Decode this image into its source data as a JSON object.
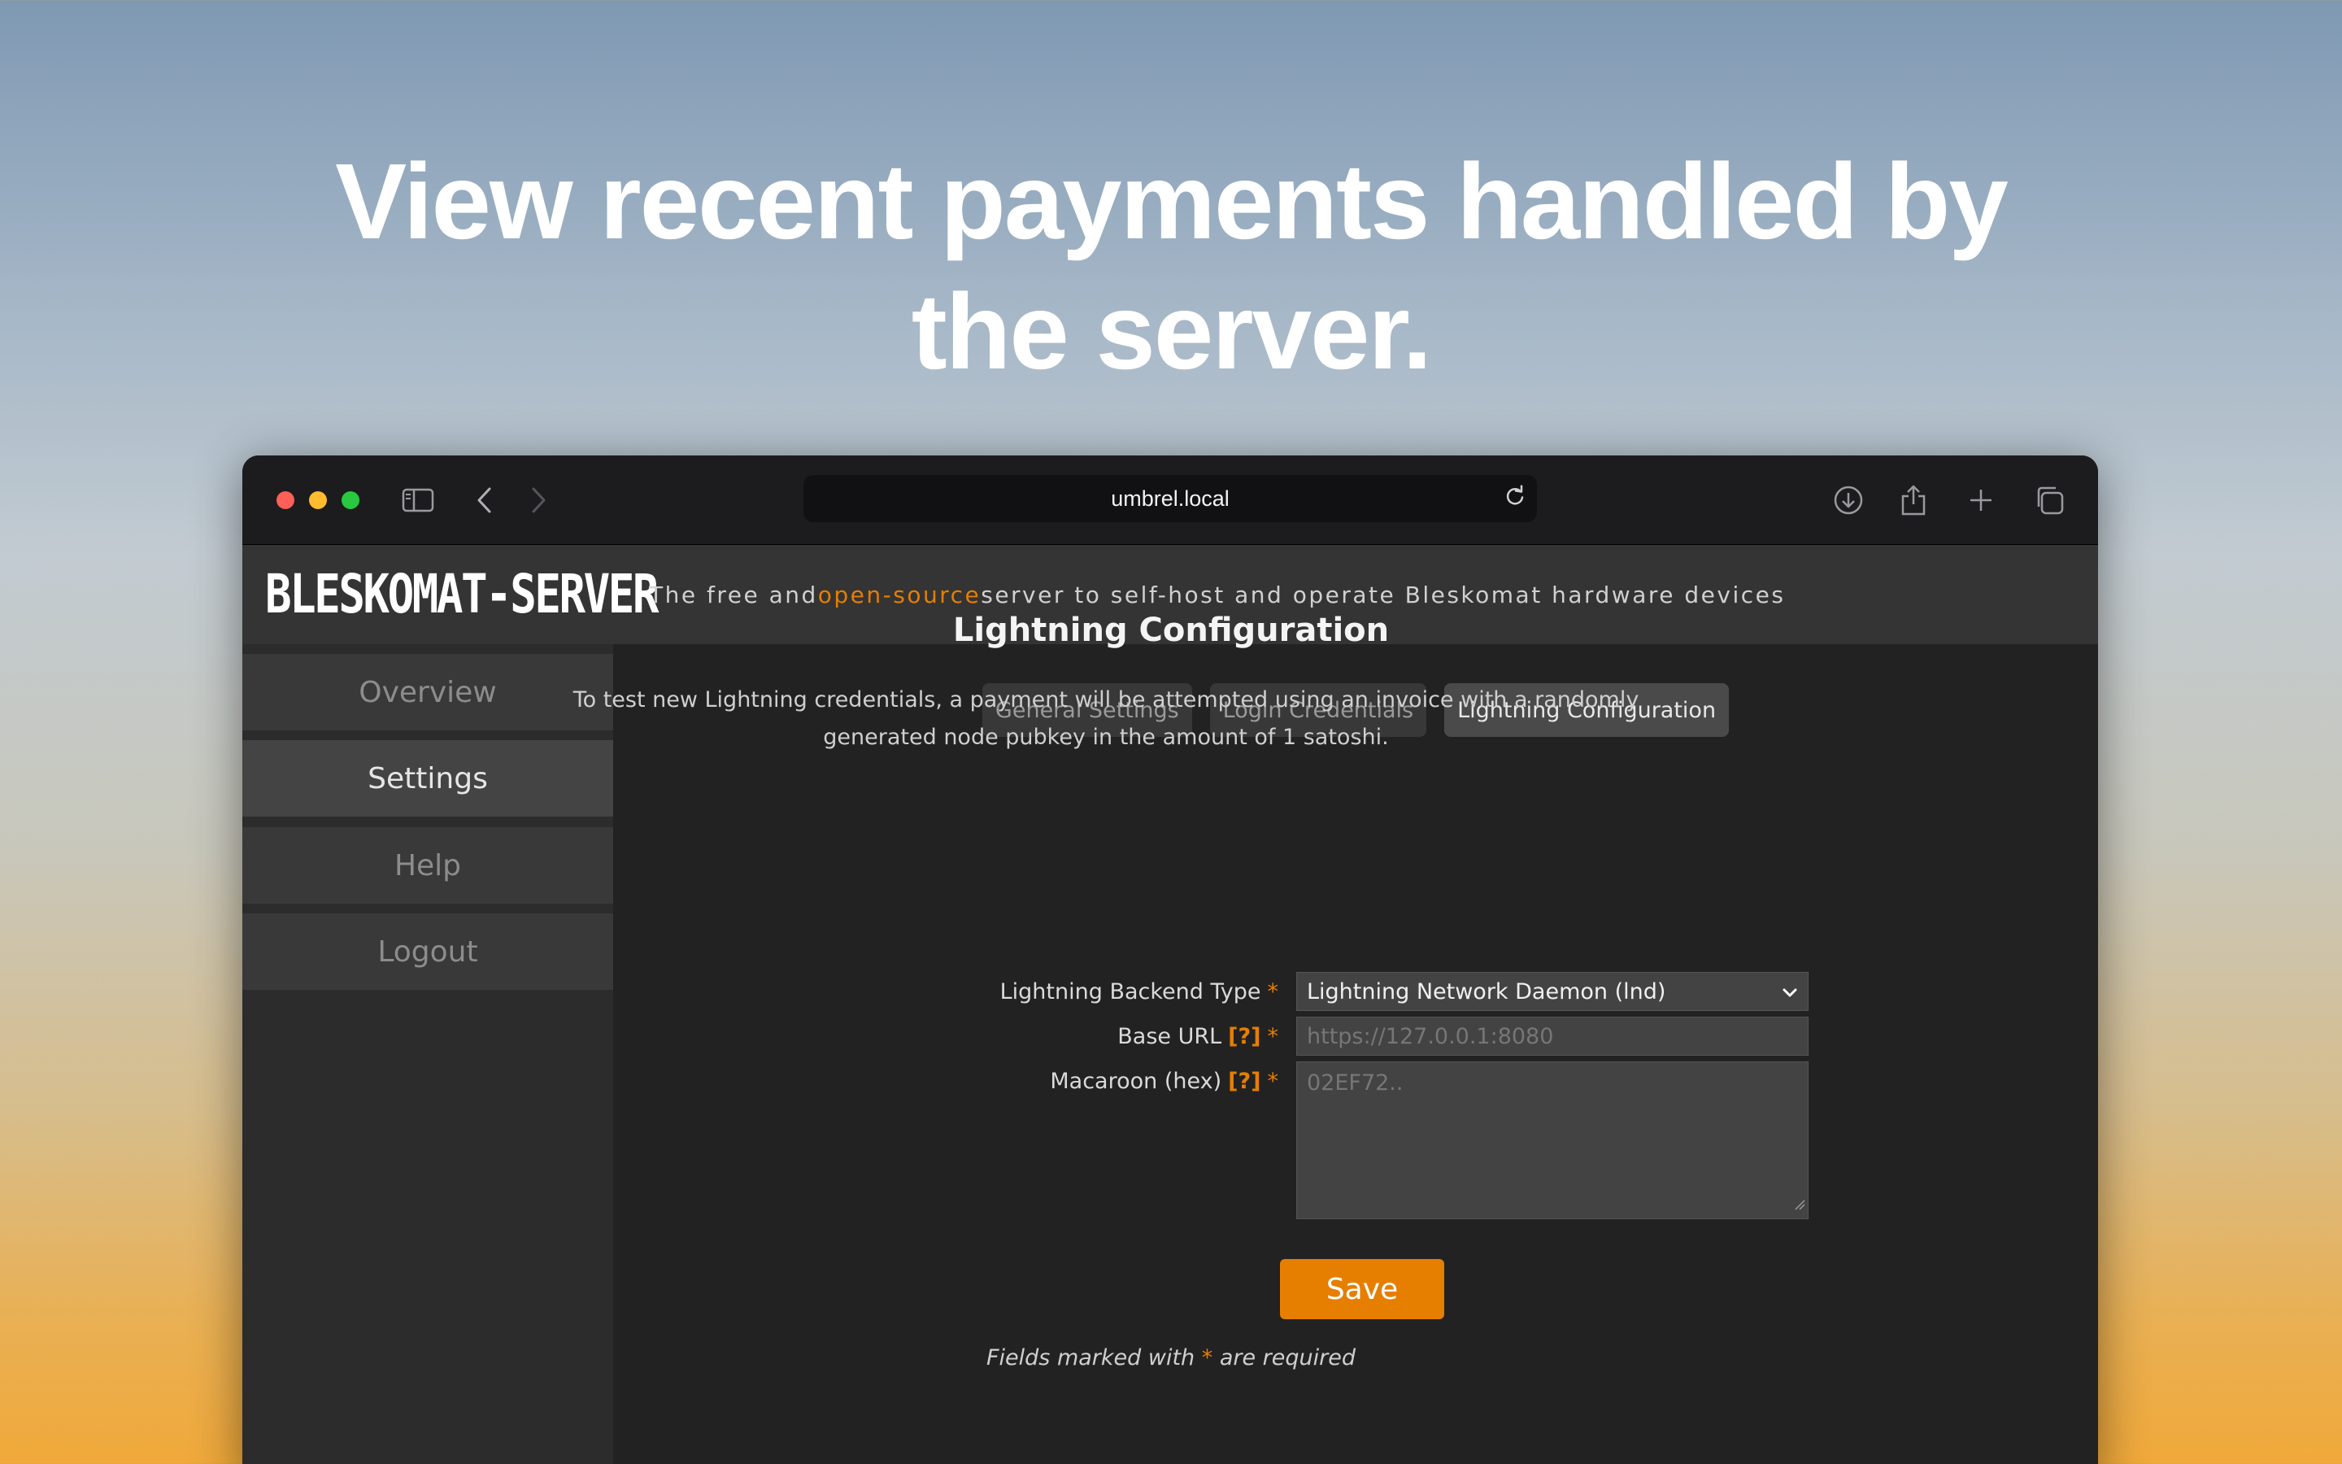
{
  "headline": {
    "line1": "View recent payments handled by",
    "line2": "the server."
  },
  "browser": {
    "url": "umbrel.local",
    "icons": [
      "sidebar-icon",
      "back-icon",
      "forward-icon",
      "reload-icon",
      "download-icon",
      "share-icon",
      "new-tab-icon",
      "tab-overview-icon"
    ]
  },
  "app": {
    "logo": "BLESKOMAT-SERVER",
    "tagline_prefix": "The free and ",
    "tagline_link": "open-source",
    "tagline_suffix": " server to self-host and operate Bleskomat hardware devices",
    "accent_color": "#e67e00"
  },
  "sidebar": {
    "items": [
      {
        "label": "Overview",
        "active": false
      },
      {
        "label": "Settings",
        "active": true
      },
      {
        "label": "Help",
        "active": false
      },
      {
        "label": "Logout",
        "active": false
      }
    ]
  },
  "tabs": [
    {
      "label": "General Settings",
      "active": false
    },
    {
      "label": "Login Credentials",
      "active": false
    },
    {
      "label": "Lightning Configuration",
      "active": true
    }
  ],
  "form": {
    "title": "Lightning Configuration",
    "description": "To test new Lightning credentials, a payment will be attempted using an invoice with a randomly generated node pubkey in the amount of 1 satoshi.",
    "backend_type": {
      "label": "Lightning Backend Type",
      "required_mark": "*",
      "value": "Lightning Network Daemon (lnd)"
    },
    "base_url": {
      "label": "Base URL",
      "help": "[?]",
      "required_mark": "*",
      "placeholder": "https://127.0.0.1:8080"
    },
    "macaroon": {
      "label": "Macaroon (hex)",
      "help": "[?]",
      "required_mark": "*",
      "placeholder": "02EF72.."
    },
    "save_label": "Save",
    "footnote_prefix": "Fields marked with ",
    "footnote_mark": "*",
    "footnote_suffix": " are required"
  }
}
